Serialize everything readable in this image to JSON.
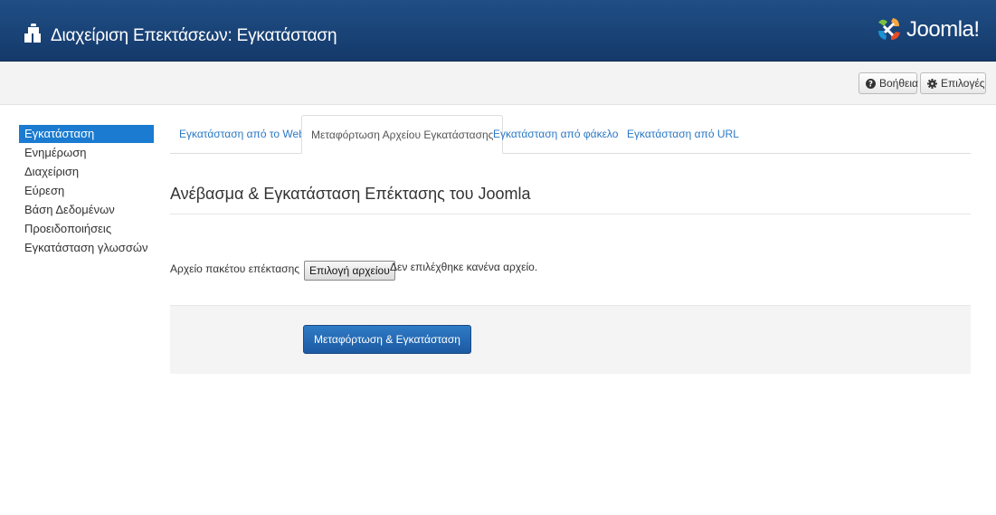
{
  "header": {
    "title": "Διαχείριση Επεκτάσεων: Εγκατάσταση",
    "title_icon": "puzzle-piece-icon",
    "logo_text": "Joomla!",
    "logo_icon": "joomla-logo-icon",
    "colors": {
      "bar": "#1f4f86",
      "logo_red": "#e44d26",
      "logo_green": "#7ac143",
      "logo_blue": "#1c92d2",
      "logo_orange": "#f9a541"
    }
  },
  "toolbar": {
    "help_label": "Βοήθεια",
    "help_icon": "question-circle-icon",
    "options_label": "Επιλογές",
    "options_icon": "gear-icon"
  },
  "sidebar": {
    "items": [
      {
        "label": "Εγκατάσταση",
        "active": true
      },
      {
        "label": "Ενημέρωση"
      },
      {
        "label": "Διαχείριση"
      },
      {
        "label": "Εύρεση"
      },
      {
        "label": "Βάση Δεδομένων"
      },
      {
        "label": "Προειδοποιήσεις"
      },
      {
        "label": "Εγκατάσταση γλωσσών"
      }
    ],
    "active_color": "#1a7bd0"
  },
  "tabs": [
    {
      "label": "Εγκατάσταση από το Web"
    },
    {
      "label": "Μεταφόρτωση Αρχείου Εγκατάστασης",
      "active": true
    },
    {
      "label": "Εγκατάσταση από φάκελο"
    },
    {
      "label": "Εγκατάσταση από URL"
    }
  ],
  "main": {
    "section_title": "Ανέβασμα & Εγκατάσταση Επέκτασης του Joomla",
    "file_label": "Αρχείο πακέτου επέκτασης",
    "file_button": "Επιλογή αρχείου",
    "file_status": "Δεν επιλέχθηκε κανένα αρχείο.",
    "upload_button": "Μεταφόρτωση & Εγκατάσταση",
    "upload_color": "#2f7bc5"
  }
}
